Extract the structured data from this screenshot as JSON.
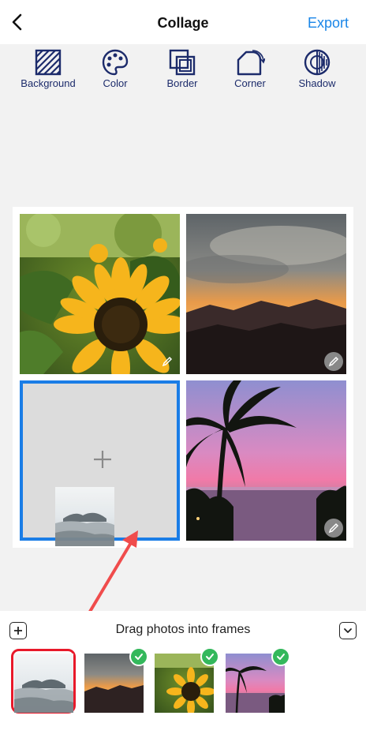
{
  "header": {
    "title": "Collage",
    "export_label": "Export",
    "back_icon": "chevron-left-icon"
  },
  "toolbar": {
    "items": [
      {
        "label": "Background",
        "icon": "background-hatch-icon"
      },
      {
        "label": "Color",
        "icon": "palette-icon"
      },
      {
        "label": "Border",
        "icon": "border-icon"
      },
      {
        "label": "Corner",
        "icon": "corner-icon"
      },
      {
        "label": "Shadow",
        "icon": "shadow-icon"
      }
    ]
  },
  "collage": {
    "frames": [
      {
        "content": "sunflower photo",
        "editable": true
      },
      {
        "content": "mountain sunset photo",
        "editable": true
      },
      {
        "content": "empty",
        "selected": true
      },
      {
        "content": "palm beach sunset photo",
        "editable": true
      }
    ],
    "dragging": "misty mountain photo"
  },
  "tray": {
    "hint": "Drag photos into frames",
    "photos": [
      {
        "content": "misty mountain photo",
        "selected": true,
        "used": false
      },
      {
        "content": "mountain sunset photo",
        "used": true
      },
      {
        "content": "sunflower photo",
        "used": true
      },
      {
        "content": "palm beach sunset photo",
        "used": true
      }
    ]
  },
  "colors": {
    "accent": "#1a86e8",
    "icon_navy": "#1c2b6b",
    "selection_blue": "#1a7de6",
    "highlight_red": "#e8192a",
    "check_green": "#34b85c"
  }
}
